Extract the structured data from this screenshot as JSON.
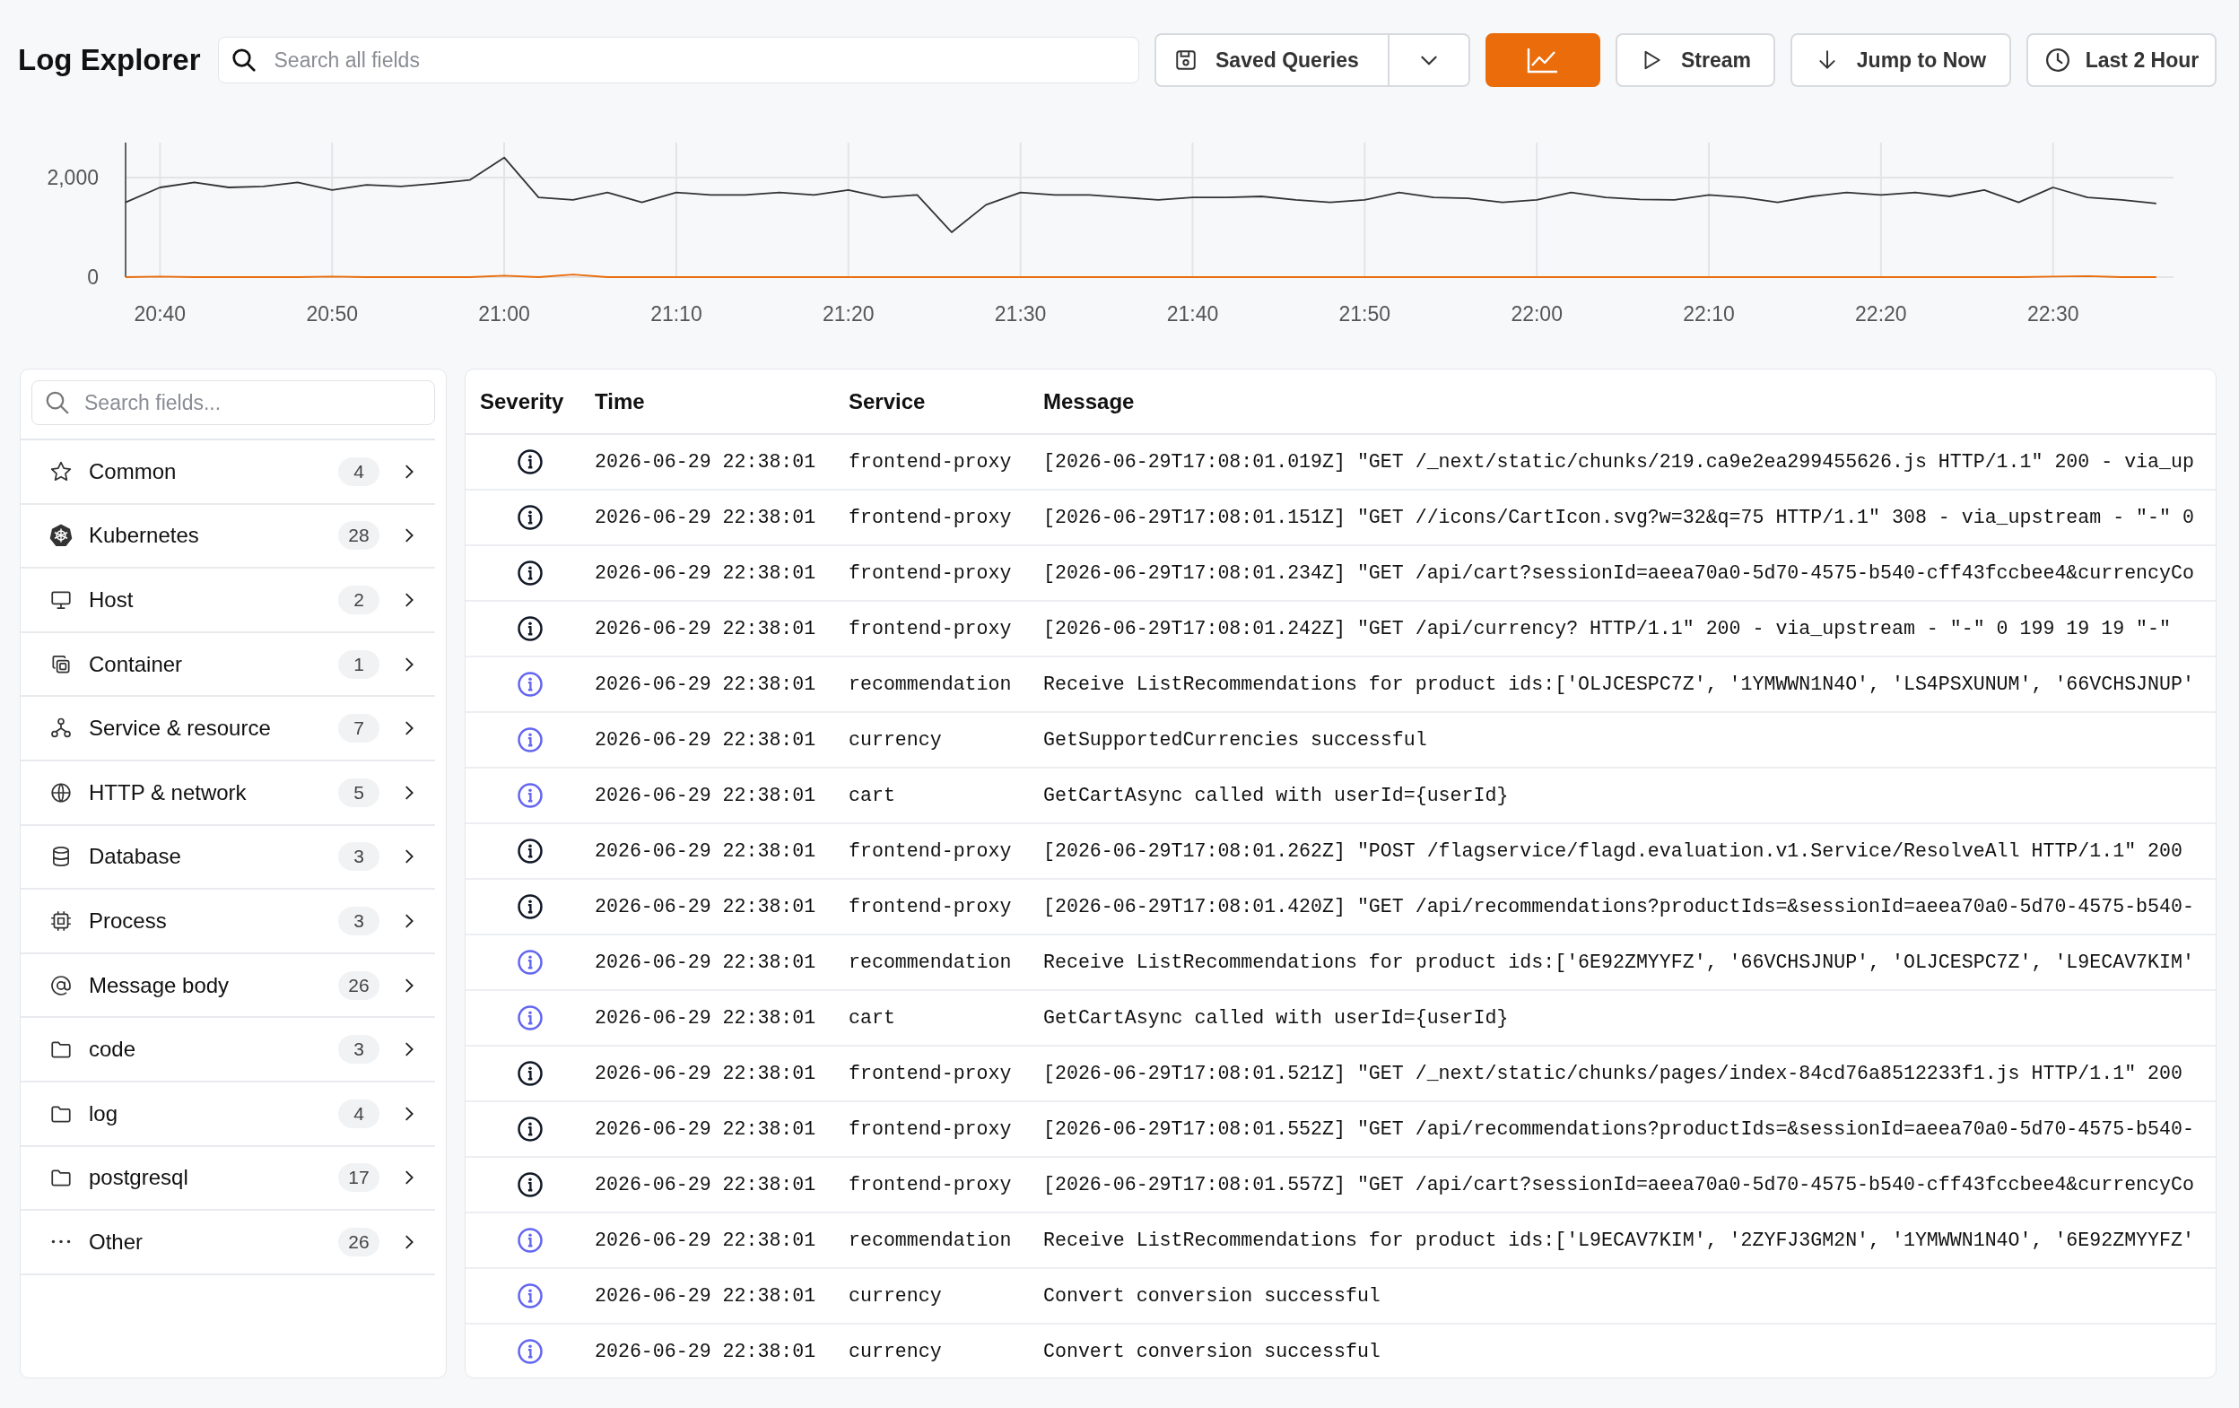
{
  "header": {
    "title": "Log Explorer",
    "search": {
      "placeholder": "Search all fields"
    },
    "buttons": {
      "saved_queries": "Saved Queries",
      "stream": "Stream",
      "jump": "Jump to Now",
      "range": "Last 2 Hour"
    }
  },
  "chart": {
    "chart_data": {
      "type": "line",
      "grid": true,
      "ylim": [
        0,
        2700
      ],
      "categories": [
        null,
        "20:40",
        null,
        null,
        null,
        null,
        "20:50",
        null,
        null,
        null,
        null,
        "21:00",
        null,
        null,
        null,
        null,
        "21:10",
        null,
        null,
        null,
        null,
        "21:20",
        null,
        null,
        null,
        null,
        "21:30",
        null,
        null,
        null,
        null,
        "21:40",
        null,
        null,
        null,
        null,
        "21:50",
        null,
        null,
        null,
        null,
        "22:00",
        null,
        null,
        null,
        null,
        "22:10",
        null,
        null,
        null,
        null,
        "22:20",
        null,
        null,
        null,
        null,
        "22:30",
        null,
        null,
        null
      ],
      "yticks": [
        {
          "value": 0,
          "label": "0"
        },
        {
          "value": 2000,
          "label": "2,000"
        }
      ],
      "series": [
        {
          "color": "#333333",
          "values": [
            1500,
            1800,
            1900,
            1800,
            1820,
            1900,
            1750,
            1850,
            1820,
            1880,
            1950,
            2400,
            1600,
            1550,
            1700,
            1500,
            1700,
            1650,
            1650,
            1700,
            1650,
            1750,
            1600,
            1650,
            900,
            1450,
            1700,
            1650,
            1650,
            1600,
            1550,
            1600,
            1600,
            1620,
            1550,
            1500,
            1550,
            1700,
            1600,
            1580,
            1500,
            1550,
            1700,
            1600,
            1560,
            1550,
            1650,
            1600,
            1500,
            1620,
            1700,
            1650,
            1700,
            1620,
            1750,
            1500,
            1800,
            1600,
            1550,
            1480
          ]
        },
        {
          "color": "#ea6c0a",
          "values": [
            0,
            10,
            0,
            0,
            0,
            0,
            10,
            0,
            0,
            0,
            0,
            30,
            0,
            50,
            0,
            0,
            0,
            0,
            0,
            0,
            0,
            0,
            0,
            0,
            0,
            0,
            0,
            0,
            0,
            0,
            0,
            0,
            0,
            0,
            0,
            0,
            0,
            0,
            0,
            0,
            0,
            0,
            0,
            0,
            0,
            0,
            0,
            0,
            0,
            0,
            0,
            0,
            0,
            0,
            0,
            0,
            10,
            20,
            0,
            0
          ]
        }
      ]
    }
  },
  "sidebar": {
    "search": {
      "placeholder": "Search fields..."
    },
    "items": [
      {
        "label": "Common",
        "count": "4"
      },
      {
        "label": "Kubernetes",
        "count": "28"
      },
      {
        "label": "Host",
        "count": "2"
      },
      {
        "label": "Container",
        "count": "1"
      },
      {
        "label": "Service & resource",
        "count": "7"
      },
      {
        "label": "HTTP & network",
        "count": "5"
      },
      {
        "label": "Database",
        "count": "3"
      },
      {
        "label": "Process",
        "count": "3"
      },
      {
        "label": "Message body",
        "count": "26"
      },
      {
        "label": "code",
        "count": "3"
      },
      {
        "label": "log",
        "count": "4"
      },
      {
        "label": "postgresql",
        "count": "17"
      },
      {
        "label": "Other",
        "count": "26"
      }
    ]
  },
  "table": {
    "columns": [
      "Severity",
      "Time",
      "Service",
      "Message"
    ],
    "rows": [
      {
        "color": "#111827",
        "time": "2026-06-29 22:38:01",
        "service": "frontend-proxy",
        "message": "[2026-06-29T17:08:01.019Z] \"GET /_next/static/chunks/219.ca9e2ea299455626.js HTTP/1.1\" 200 - via_up"
      },
      {
        "color": "#111827",
        "time": "2026-06-29 22:38:01",
        "service": "frontend-proxy",
        "message": "[2026-06-29T17:08:01.151Z] \"GET //icons/CartIcon.svg?w=32&q=75 HTTP/1.1\" 308 - via_upstream - \"-\" 0"
      },
      {
        "color": "#111827",
        "time": "2026-06-29 22:38:01",
        "service": "frontend-proxy",
        "message": "[2026-06-29T17:08:01.234Z] \"GET /api/cart?sessionId=aeea70a0-5d70-4575-b540-cff43fccbee4&currencyCo"
      },
      {
        "color": "#111827",
        "time": "2026-06-29 22:38:01",
        "service": "frontend-proxy",
        "message": "[2026-06-29T17:08:01.242Z] \"GET /api/currency? HTTP/1.1\" 200 - via_upstream - \"-\" 0 199 19 19 \"-\""
      },
      {
        "color": "#6366f1",
        "time": "2026-06-29 22:38:01",
        "service": "recommendation",
        "message": "Receive ListRecommendations for product ids:['OLJCESPC7Z', '1YMWWN1N4O', 'LS4PSXUNUM', '66VCHSJNUP'"
      },
      {
        "color": "#6366f1",
        "time": "2026-06-29 22:38:01",
        "service": "currency",
        "message": "GetSupportedCurrencies successful"
      },
      {
        "color": "#6366f1",
        "time": "2026-06-29 22:38:01",
        "service": "cart",
        "message": "GetCartAsync called with userId={userId}"
      },
      {
        "color": "#111827",
        "time": "2026-06-29 22:38:01",
        "service": "frontend-proxy",
        "message": "[2026-06-29T17:08:01.262Z] \"POST /flagservice/flagd.evaluation.v1.Service/ResolveAll HTTP/1.1\" 200"
      },
      {
        "color": "#111827",
        "time": "2026-06-29 22:38:01",
        "service": "frontend-proxy",
        "message": "[2026-06-29T17:08:01.420Z] \"GET /api/recommendations?productIds=&sessionId=aeea70a0-5d70-4575-b540-"
      },
      {
        "color": "#6366f1",
        "time": "2026-06-29 22:38:01",
        "service": "recommendation",
        "message": "Receive ListRecommendations for product ids:['6E92ZMYYFZ', '66VCHSJNUP', 'OLJCESPC7Z', 'L9ECAV7KIM'"
      },
      {
        "color": "#6366f1",
        "time": "2026-06-29 22:38:01",
        "service": "cart",
        "message": "GetCartAsync called with userId={userId}"
      },
      {
        "color": "#111827",
        "time": "2026-06-29 22:38:01",
        "service": "frontend-proxy",
        "message": "[2026-06-29T17:08:01.521Z] \"GET /_next/static/chunks/pages/index-84cd76a8512233f1.js HTTP/1.1\" 200"
      },
      {
        "color": "#111827",
        "time": "2026-06-29 22:38:01",
        "service": "frontend-proxy",
        "message": "[2026-06-29T17:08:01.552Z] \"GET /api/recommendations?productIds=&sessionId=aeea70a0-5d70-4575-b540-"
      },
      {
        "color": "#111827",
        "time": "2026-06-29 22:38:01",
        "service": "frontend-proxy",
        "message": "[2026-06-29T17:08:01.557Z] \"GET /api/cart?sessionId=aeea70a0-5d70-4575-b540-cff43fccbee4&currencyCo"
      },
      {
        "color": "#6366f1",
        "time": "2026-06-29 22:38:01",
        "service": "recommendation",
        "message": "Receive ListRecommendations for product ids:['L9ECAV7KIM', '2ZYFJ3GM2N', '1YMWWN1N4O', '6E92ZMYYFZ'"
      },
      {
        "color": "#6366f1",
        "time": "2026-06-29 22:38:01",
        "service": "currency",
        "message": "Convert conversion successful"
      },
      {
        "color": "#6366f1",
        "time": "2026-06-29 22:38:01",
        "service": "currency",
        "message": "Convert conversion successful"
      }
    ]
  }
}
